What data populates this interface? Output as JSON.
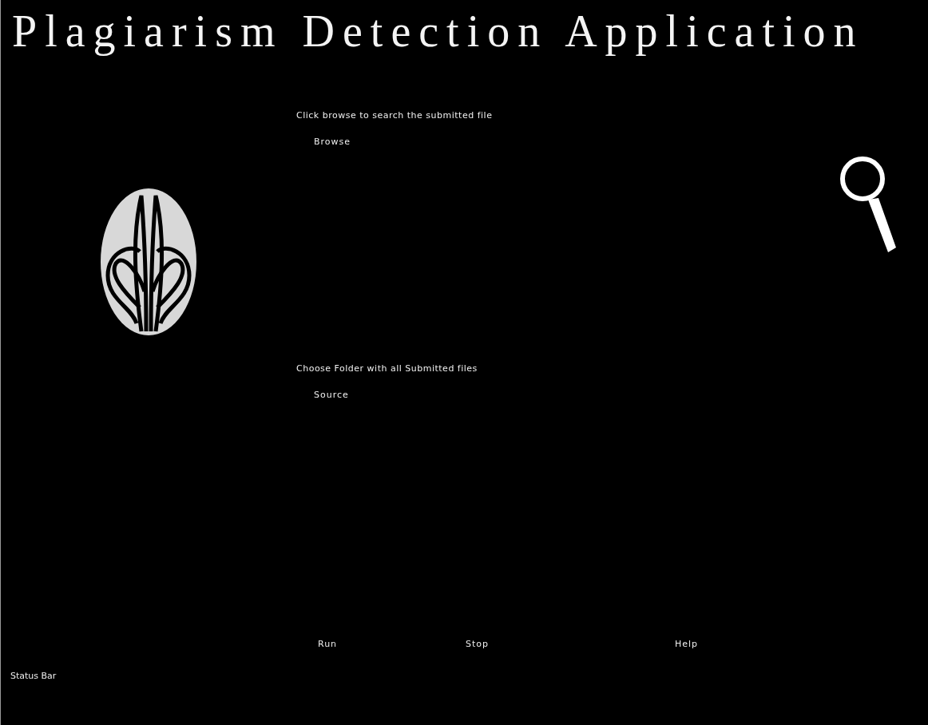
{
  "title": "Plagiarism Detection Application",
  "file_section": {
    "label": "Click browse to search the submitted file",
    "button": "Browse"
  },
  "folder_section": {
    "label": "Choose Folder with all Submitted files",
    "button": "Source"
  },
  "actions": [
    "Run",
    "Stop",
    "Help"
  ],
  "status_bar": "Status Bar"
}
